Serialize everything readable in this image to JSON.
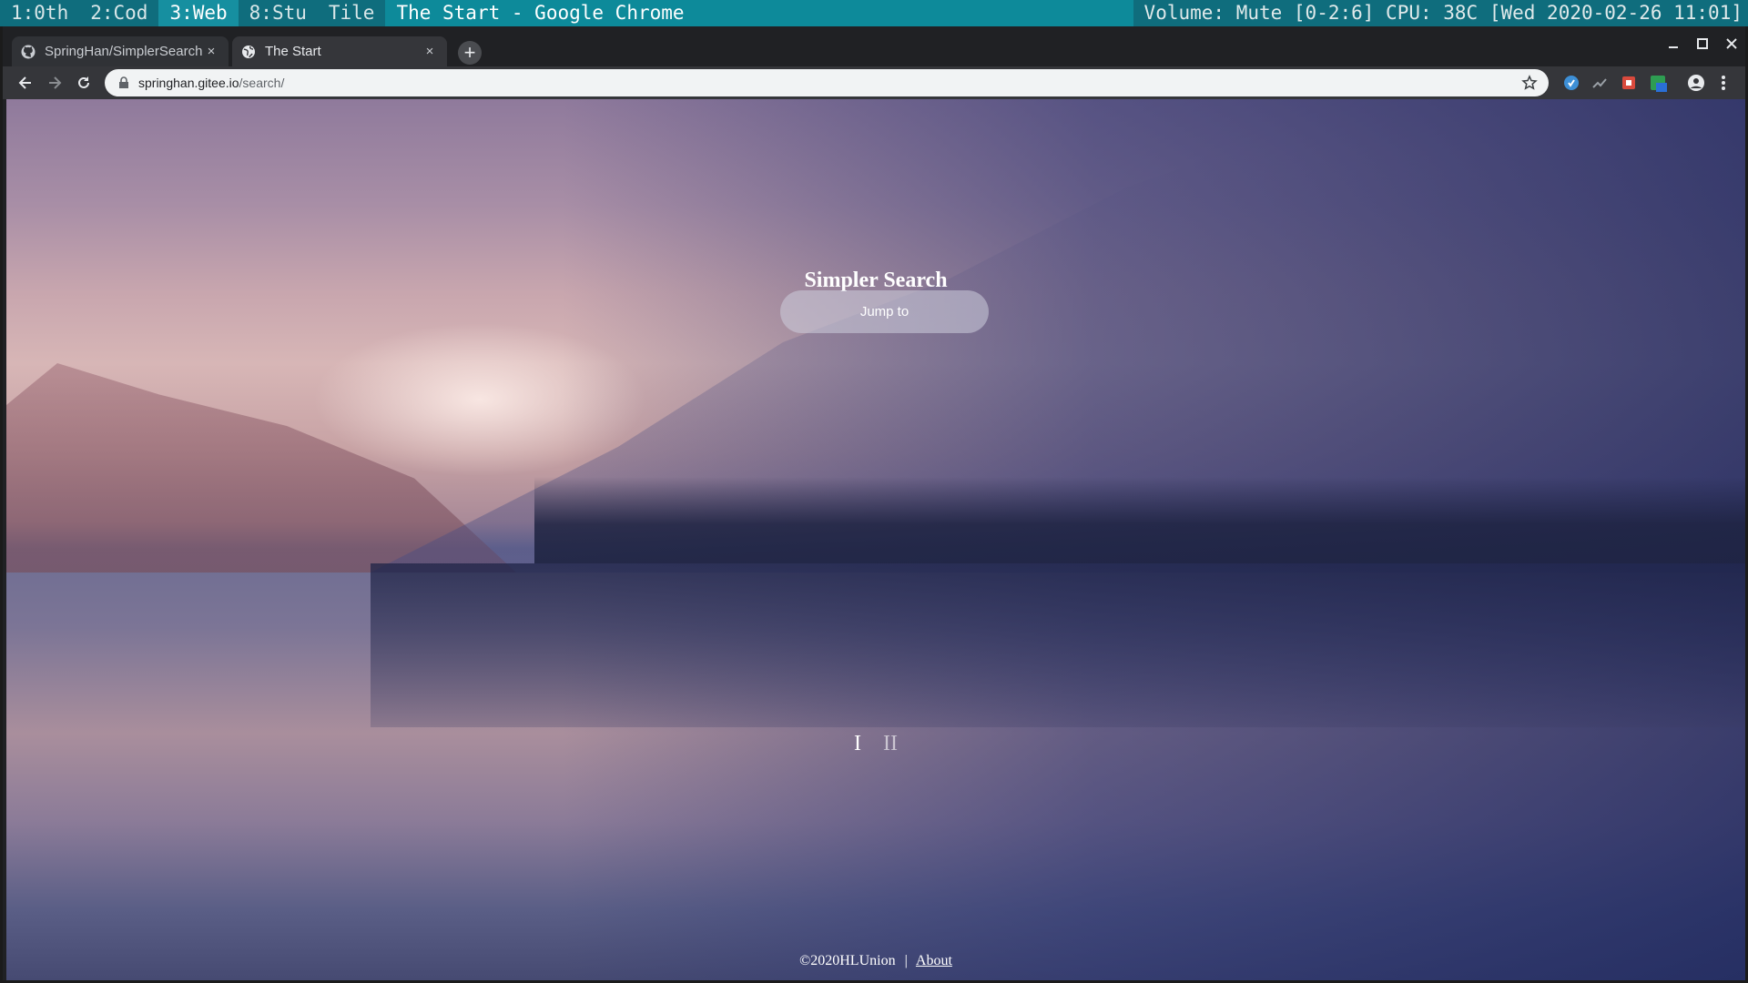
{
  "wm": {
    "workspaces": [
      "1:0th",
      "2:Cod",
      "3:Web",
      "8:Stu"
    ],
    "active_workspace": "3:Web",
    "layout": "Tile",
    "window_title": "The Start - Google Chrome",
    "status": "Volume: Mute [0-2:6] CPU: 38C [Wed 2020-02-26 11:01]"
  },
  "tabs": [
    {
      "title": "SpringHan/SimplerSearch",
      "icon": "github-icon",
      "close": "×"
    },
    {
      "title": "The Start",
      "icon": "globe-icon",
      "close": "×"
    }
  ],
  "new_tab": "+",
  "address": {
    "host": "springhan.gitee.io",
    "path": "/search/"
  },
  "page": {
    "title": "Simpler Search",
    "button": "Jump to",
    "pager": [
      "I",
      "II"
    ],
    "footer": {
      "copyright": "©2020HLUnion",
      "separator": "|",
      "about": "About"
    }
  }
}
